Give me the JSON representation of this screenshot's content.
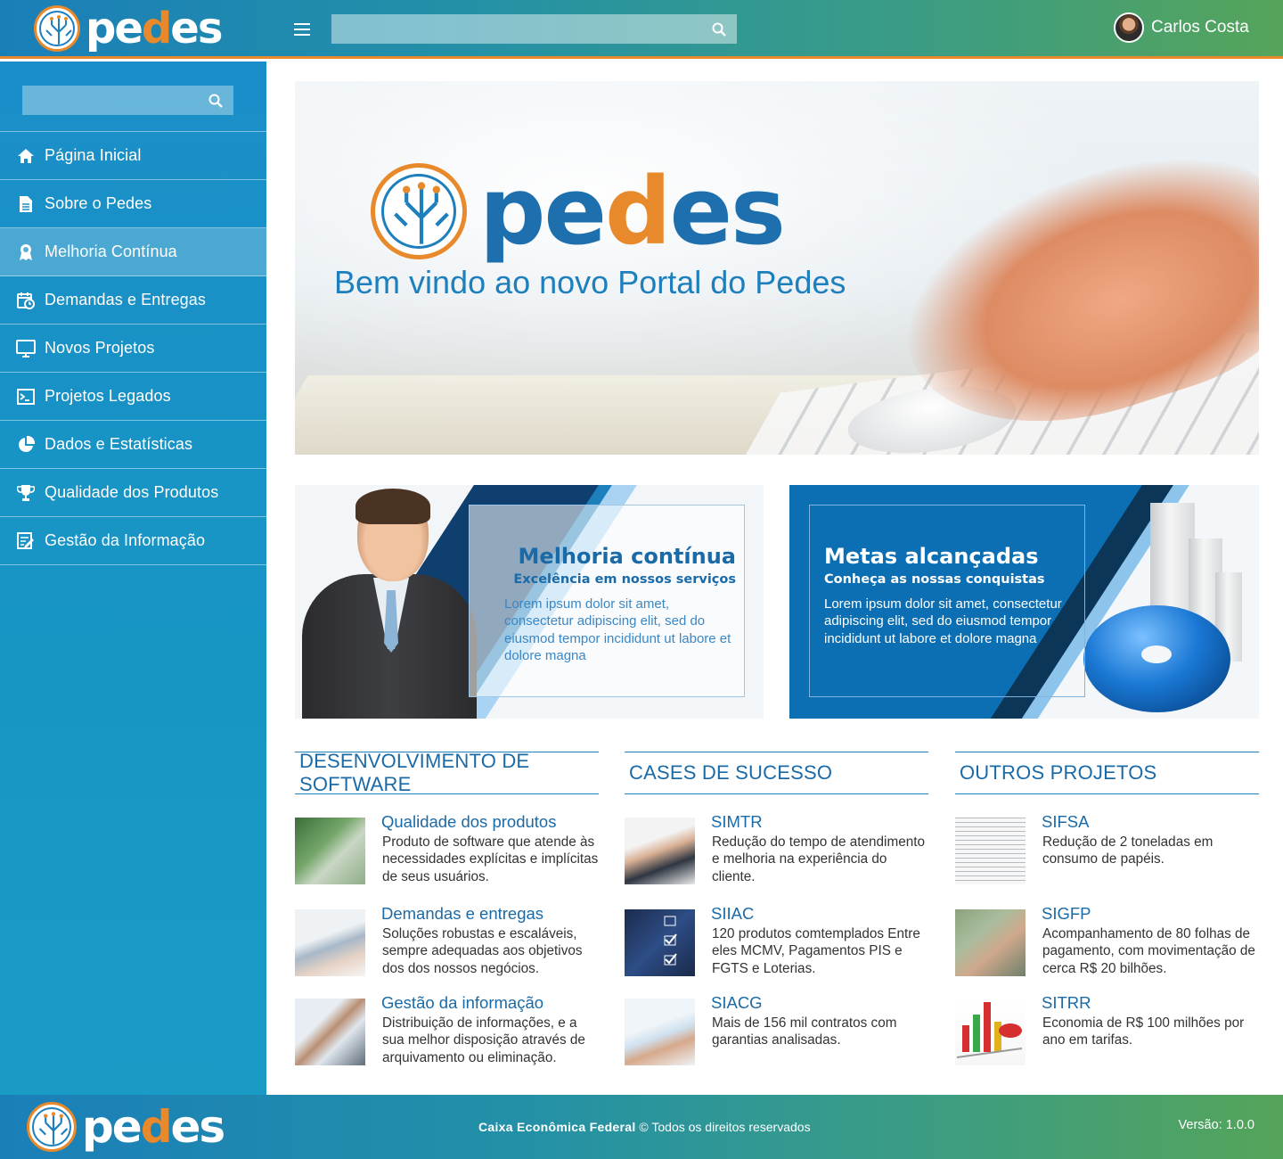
{
  "brand": {
    "logo_text": "pedes",
    "colors": {
      "blue": "#1a7fb8",
      "green": "#55a45a",
      "orange": "#e8892b",
      "title_blue": "#1a6aa7"
    }
  },
  "header": {
    "menu_icon": "hamburger-icon",
    "search": {
      "placeholder": "",
      "icon": "search-icon"
    },
    "user": {
      "name": "Carlos Costa"
    }
  },
  "sidebar": {
    "search": {
      "placeholder": "",
      "icon": "search-icon"
    },
    "items": [
      {
        "label": "Página Inicial",
        "icon": "home-icon"
      },
      {
        "label": "Sobre o Pedes",
        "icon": "document-icon"
      },
      {
        "label": "Melhoria Contínua",
        "icon": "award-icon",
        "active": true
      },
      {
        "label": "Demandas e Entregas",
        "icon": "calendar-clock-icon"
      },
      {
        "label": "Novos Projetos",
        "icon": "monitor-icon"
      },
      {
        "label": "Projetos Legados",
        "icon": "terminal-icon"
      },
      {
        "label": "Dados e Estatísticas",
        "icon": "pie-chart-icon"
      },
      {
        "label": "Qualidade dos Produtos",
        "icon": "trophy-icon"
      },
      {
        "label": "Gestão da Informação",
        "icon": "edit-list-icon"
      }
    ]
  },
  "hero": {
    "title": "Bem vindo ao novo Portal do Pedes"
  },
  "promos": [
    {
      "title": "Melhoria contínua",
      "subtitle": "Excelência em nossos serviços",
      "body": "Lorem ipsum dolor sit amet, consectetur adipiscing elit, sed do eiusmod tempor incididunt ut labore et dolore magna"
    },
    {
      "title": "Metas alcançadas",
      "subtitle": "Conheça as nossas conquistas",
      "body": "Lorem ipsum dolor sit amet, consectetur adipiscing elit, sed do eiusmod tempor incididunt ut labore et dolore magna"
    }
  ],
  "columns": [
    {
      "heading": "DESENVOLVIMENTO DE SOFTWARE",
      "items": [
        {
          "title": "Qualidade dos produtos",
          "desc": "Produto de software que atende às necessidades explícitas e implícitas de seus usuários."
        },
        {
          "title": "Demandas e entregas",
          "desc": "Soluções robustas e escaláveis, sempre adequadas aos objetivos dos dos nossos negócios."
        },
        {
          "title": "Gestão da informação",
          "desc": "Distribuição de informações, e a sua melhor disposição através de arquivamento ou eliminação."
        }
      ]
    },
    {
      "heading": "CASES DE SUCESSO",
      "items": [
        {
          "title": "SIMTR",
          "desc": "Redução do tempo de atendimento e melhoria na experiência do cliente."
        },
        {
          "title": "SIIAC",
          "desc": "120 produtos comtemplados Entre eles MCMV, Pagamentos PIS e FGTS e Loterias."
        },
        {
          "title": "SIACG",
          "desc": "Mais de 156 mil contratos com garantias analisadas."
        }
      ]
    },
    {
      "heading": "OUTROS PROJETOS",
      "items": [
        {
          "title": "SIFSA",
          "desc": "Redução de 2 toneladas em consumo de papéis."
        },
        {
          "title": "SIGFP",
          "desc": "Acompanhamento de 80 folhas de pagamento, com movimentação de cerca R$ 20 bilhões."
        },
        {
          "title": "SITRR",
          "desc": "Economia de R$ 100 milhões por ano em tarifas."
        }
      ]
    }
  ],
  "footer": {
    "company": "Caixa Econômica Federal",
    "rights": "© Todos os direitos reservados",
    "version": "Versão: 1.0.0"
  }
}
